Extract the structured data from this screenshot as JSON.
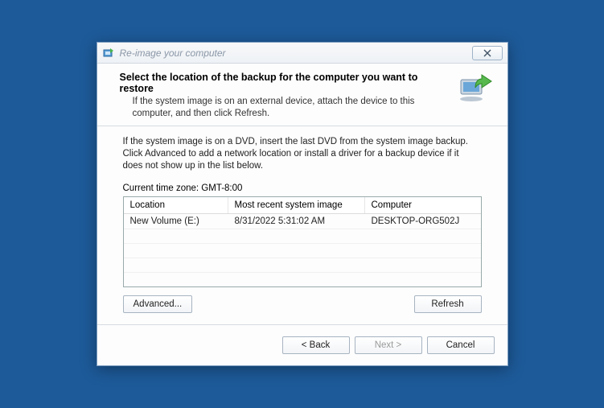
{
  "titlebar": {
    "title": "Re-image your computer"
  },
  "header": {
    "bold": "Select the location of the backup for the computer you want to restore",
    "desc": "If the system image is on an external device, attach the device to this computer, and then click Refresh."
  },
  "body": {
    "text": "If the system image is on a DVD, insert the last DVD from the system image backup. Click Advanced to add a network location or install a driver for a backup device if it does not show up in the list below."
  },
  "timezone": "Current time zone: GMT-8:00",
  "table": {
    "headers": {
      "location": "Location",
      "image": "Most recent system image",
      "computer": "Computer"
    },
    "rows": [
      {
        "location": "New Volume (E:)",
        "image": "8/31/2022 5:31:02 AM",
        "computer": "DESKTOP-ORG502J"
      }
    ]
  },
  "buttons": {
    "advanced": "Advanced...",
    "refresh": "Refresh",
    "back": "< Back",
    "next": "Next >",
    "cancel": "Cancel"
  }
}
